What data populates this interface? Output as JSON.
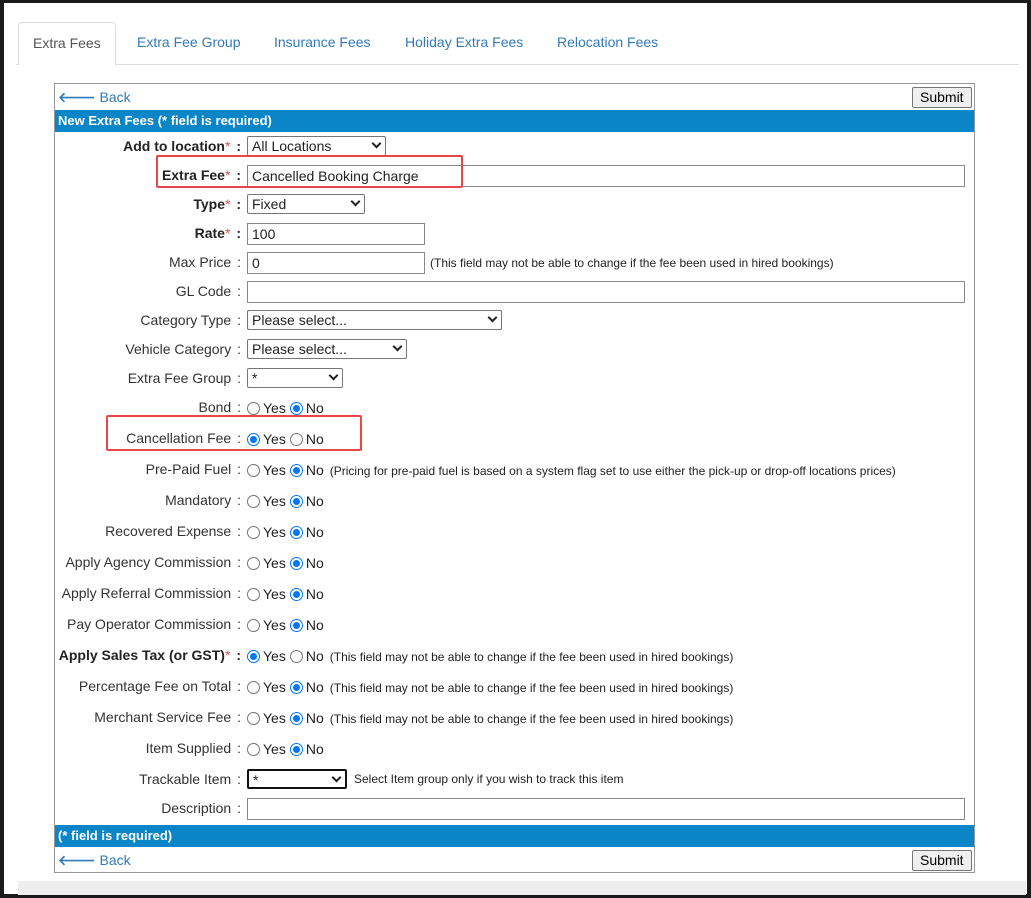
{
  "tabs": [
    "Extra Fees",
    "Extra Fee Group",
    "Insurance Fees",
    "Holiday Extra Fees",
    "Relocation Fees"
  ],
  "nav": {
    "back_label": "Back",
    "submit_label": "Submit"
  },
  "form": {
    "header": "New Extra Fees (* field is required)",
    "footer": "(* field is required)",
    "add_to_location": {
      "label": "Add to location",
      "value": "All Locations"
    },
    "extra_fee": {
      "label": "Extra Fee",
      "value": "Cancelled Booking Charge"
    },
    "type": {
      "label": "Type",
      "value": "Fixed"
    },
    "rate": {
      "label": "Rate",
      "value": "100"
    },
    "max_price": {
      "label": "Max Price",
      "value": "0",
      "note": "(This field may not be able to change if the fee been used in hired bookings)"
    },
    "gl_code": {
      "label": "GL Code",
      "value": ""
    },
    "category_type": {
      "label": "Category Type",
      "value": "Please select..."
    },
    "vehicle_category": {
      "label": "Vehicle Category",
      "value": "Please select..."
    },
    "extra_fee_group": {
      "label": "Extra Fee Group",
      "value": "*"
    },
    "yes_label": "Yes",
    "no_label": "No",
    "radios": [
      {
        "label": "Bond",
        "selected": "No"
      },
      {
        "label": "Cancellation Fee",
        "selected": "Yes"
      },
      {
        "label": "Pre-Paid Fuel",
        "selected": "No",
        "note": "(Pricing for pre-paid fuel is based on a system flag set to use either the pick-up or drop-off locations prices)"
      },
      {
        "label": "Mandatory",
        "selected": "No"
      },
      {
        "label": "Recovered Expense",
        "selected": "No"
      },
      {
        "label": "Apply Agency Commission",
        "selected": "No"
      },
      {
        "label": "Apply Referral Commission",
        "selected": "No"
      },
      {
        "label": "Pay Operator Commission",
        "selected": "No"
      },
      {
        "label": "Apply Sales Tax (or GST)",
        "selected": "Yes",
        "required": true,
        "note": "(This field may not be able to change if the fee been used in hired bookings)"
      },
      {
        "label": "Percentage Fee on Total",
        "selected": "No",
        "note": "(This field may not be able to change if the fee been used in hired bookings)"
      },
      {
        "label": "Merchant Service Fee",
        "selected": "No",
        "note": "(This field may not be able to change if the fee been used in hired bookings)"
      },
      {
        "label": "Item Supplied",
        "selected": "No"
      }
    ],
    "trackable_item": {
      "label": "Trackable Item",
      "value": "*",
      "note": "Select Item group only if you wish to track this item"
    },
    "description": {
      "label": "Description",
      "value": ""
    }
  },
  "colors": {
    "header_bar": "#0a86c8",
    "link": "#337ab7",
    "required": "#d9534f",
    "highlight": "#e8474a"
  }
}
